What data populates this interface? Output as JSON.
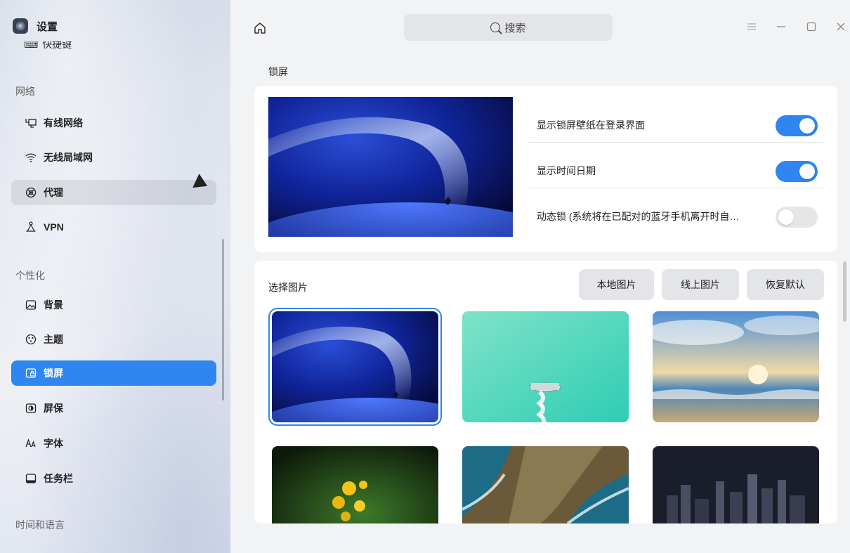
{
  "app": {
    "title": "设置",
    "icon": "settings-app-icon"
  },
  "sidebar": {
    "clipped_item": "快捷键",
    "sections": [
      {
        "label": "网络",
        "items": [
          {
            "label": "有线网络",
            "icon": "wired-network-icon"
          },
          {
            "label": "无线局域网",
            "icon": "wifi-icon"
          },
          {
            "label": "代理",
            "icon": "proxy-icon"
          },
          {
            "label": "VPN",
            "icon": "vpn-icon"
          }
        ]
      },
      {
        "label": "个性化",
        "items": [
          {
            "label": "背景",
            "icon": "background-icon"
          },
          {
            "label": "主题",
            "icon": "theme-icon"
          },
          {
            "label": "锁屏",
            "icon": "lockscreen-icon"
          },
          {
            "label": "屏保",
            "icon": "screensaver-icon"
          },
          {
            "label": "字体",
            "icon": "font-icon"
          },
          {
            "label": "任务栏",
            "icon": "taskbar-icon"
          }
        ]
      },
      {
        "label": "时间和语言",
        "items": []
      }
    ],
    "active_item": "锁屏",
    "hover_item": "代理"
  },
  "titlebar": {
    "search_label": "搜索",
    "icons": [
      "home-icon",
      "search-icon",
      "menu-icon",
      "minimize-icon",
      "maximize-icon",
      "close-icon"
    ]
  },
  "page": {
    "title": "锁屏",
    "settings": [
      {
        "label": "显示锁屏壁纸在登录界面",
        "enabled": true
      },
      {
        "label": "显示时间日期",
        "enabled": true
      },
      {
        "label": "动态锁 (系统将在已配对的蓝牙手机离开时自…",
        "enabled": false
      }
    ],
    "picker": {
      "label": "选择图片",
      "buttons": [
        "本地图片",
        "线上图片",
        "恢复默认"
      ],
      "selected_index": 0,
      "thumbnails": [
        "milky-way-night",
        "teal-spiral-tower",
        "sunset-beach-birds",
        "yellow-flowers",
        "aerial-coast",
        "city-night-skyline"
      ]
    }
  },
  "colors": {
    "accent": "#2f86f0",
    "toggle_off": "#e6e6e6",
    "button_bg": "#e4e5e8"
  }
}
